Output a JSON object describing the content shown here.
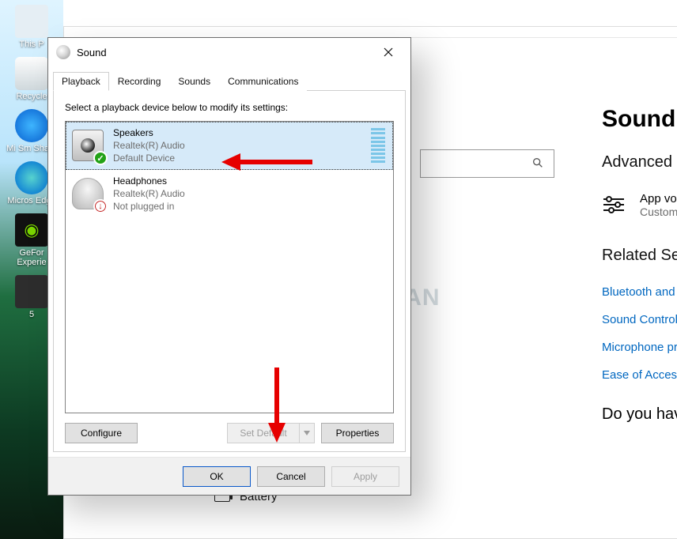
{
  "dialog": {
    "title": "Sound",
    "tabs": [
      "Playback",
      "Recording",
      "Sounds",
      "Communications"
    ],
    "active_tab": 0,
    "instruction": "Select a playback device below to modify its settings:",
    "devices": [
      {
        "name": "Speakers",
        "driver": "Realtek(R) Audio",
        "status": "Default Device",
        "selected": true,
        "badge": "check"
      },
      {
        "name": "Headphones",
        "driver": "Realtek(R) Audio",
        "status": "Not plugged in",
        "selected": false,
        "badge": "unplugged"
      }
    ],
    "buttons": {
      "configure": "Configure",
      "set_default": "Set Default",
      "properties": "Properties"
    },
    "footer": {
      "ok": "OK",
      "cancel": "Cancel",
      "apply": "Apply"
    }
  },
  "settings": {
    "page_title": "Sound",
    "advanced_header": "Advanced sound",
    "app_volume_title": "App volume  d",
    "app_volume_sub": "Customise app v",
    "related_header": "Related Settings",
    "links": [
      "Bluetooth and other de",
      "Sound Control Panel",
      "Microphone privacy se",
      "Ease of Access audio se"
    ],
    "question": "Do you have a q",
    "nav_battery": "Battery"
  },
  "desktop_icons": [
    "This P",
    "Recycle",
    "Mi Sm Share",
    "Micros Edge",
    "GeFor Experie",
    "5"
  ],
  "watermark": "BIGYAAN"
}
